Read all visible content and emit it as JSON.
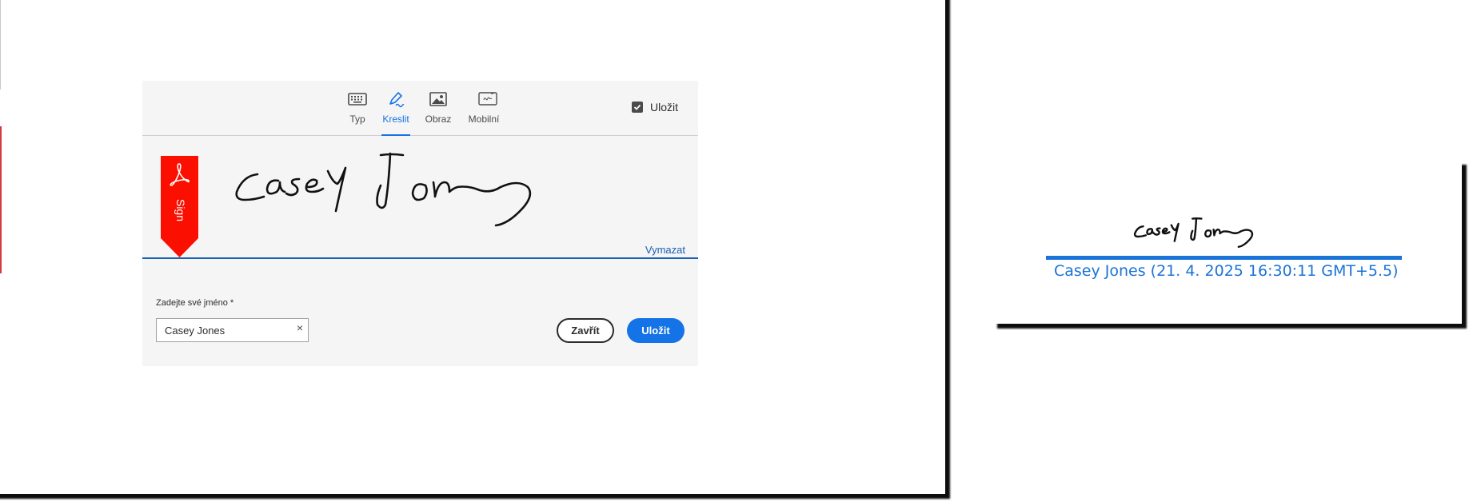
{
  "dialog": {
    "tabs": [
      {
        "label": "Typ",
        "icon": "keyboard-icon",
        "active": false
      },
      {
        "label": "Kreslit",
        "icon": "pen-icon",
        "active": true
      },
      {
        "label": "Obraz",
        "icon": "image-icon",
        "active": false
      },
      {
        "label": "Mobilní",
        "icon": "mobile-device-icon",
        "active": false
      }
    ],
    "save_checkbox": {
      "label": "Uložit",
      "checked": true
    },
    "sign_badge": {
      "text": "Sign",
      "icon": "acrobat-icon"
    },
    "clear_link": "Vymazat",
    "name_field": {
      "label": "Zadejte své jméno *",
      "value": "Casey Jones"
    },
    "buttons": {
      "close_label": "Zavřít",
      "save_label": "Uložit"
    }
  },
  "placed_signature": {
    "caption": "Casey Jones (21. 4. 2025 16:30:11 GMT+5.5)"
  },
  "colors": {
    "accent": "#1473e6",
    "sign_badge": "#fa0f00",
    "caption": "#1a73d8"
  }
}
